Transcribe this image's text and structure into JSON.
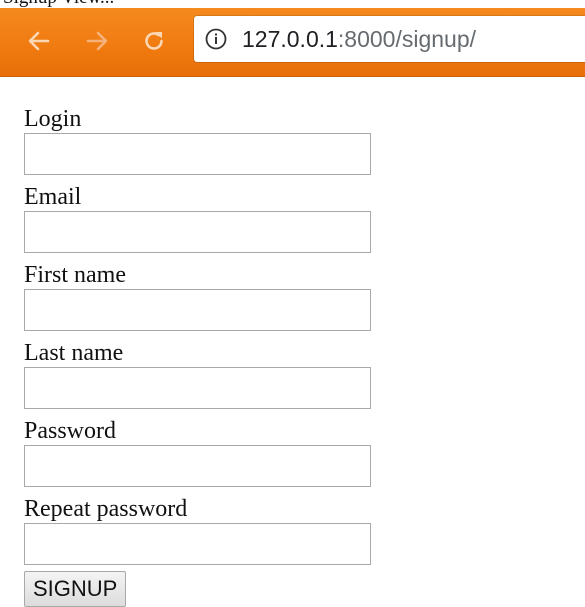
{
  "window": {
    "tab_title": "Signup View..."
  },
  "toolbar": {
    "back_icon": "back-arrow-icon",
    "forward_icon": "forward-arrow-icon",
    "reload_icon": "reload-icon",
    "info_icon": "info-icon",
    "accent_color": "#f07a10",
    "url_host": "127.0.0.1",
    "url_rest": ":8000/signup/"
  },
  "form": {
    "fields": [
      {
        "label": "Login",
        "value": ""
      },
      {
        "label": "Email",
        "value": ""
      },
      {
        "label": "First name",
        "value": ""
      },
      {
        "label": "Last name",
        "value": ""
      },
      {
        "label": "Password",
        "value": ""
      },
      {
        "label": "Repeat password",
        "value": ""
      }
    ],
    "submit_label": "SIGNUP"
  }
}
